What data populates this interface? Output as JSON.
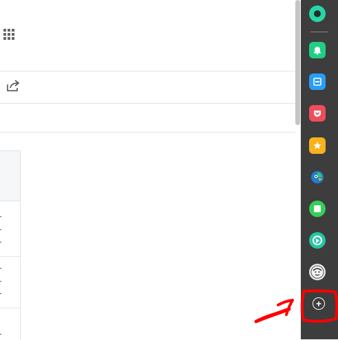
{
  "main": {
    "icons": {
      "apps": "apps-grid-icon",
      "share": "share-icon"
    }
  },
  "sidebar": {
    "items": [
      {
        "name": "status-dot-icon",
        "color": "#26d7a6"
      },
      {
        "name": "bell-icon",
        "color": "#1fcf84"
      },
      {
        "name": "inbox-icon",
        "color": "#2a9df4"
      },
      {
        "name": "pocket-icon",
        "color": "#ef4d5b"
      },
      {
        "name": "star-icon",
        "color": "#f8b21c"
      },
      {
        "name": "parrot-icon",
        "color": "#1c7ed6"
      },
      {
        "name": "square-icon",
        "color": "#34d058"
      },
      {
        "name": "play-icon",
        "color": "#26c6a1"
      },
      {
        "name": "face-avatar-icon",
        "color": "#e8e8e8"
      }
    ],
    "add_button_label": "+"
  },
  "annotation": {
    "color": "#ff0000",
    "shape": "highlight-rectangle-and-arrow"
  }
}
